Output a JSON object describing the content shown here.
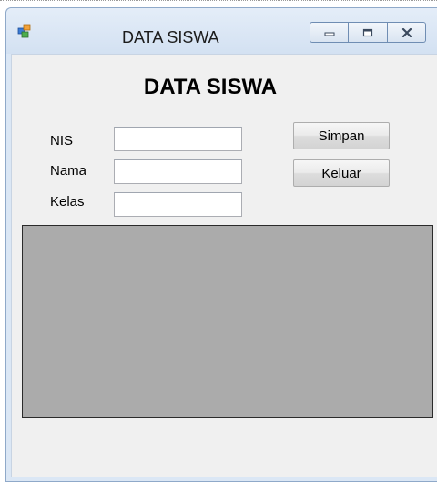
{
  "window": {
    "title": "DATA SISWA",
    "controls": {
      "minimize": "minimize",
      "maximize": "maximize",
      "close": "close"
    }
  },
  "form": {
    "heading": "DATA SISWA",
    "fields": [
      {
        "label": "NIS",
        "value": ""
      },
      {
        "label": "Nama",
        "value": ""
      },
      {
        "label": "Kelas",
        "value": ""
      }
    ],
    "buttons": {
      "save_label": "Simpan",
      "exit_label": "Keluar"
    }
  },
  "data_grid": {
    "rows": []
  },
  "colors": {
    "titlebar": "#dbe7f5",
    "client_background": "#f0f0f0",
    "grid_background": "#ababab"
  },
  "icons": [
    "app-window-icon",
    "minimize-icon",
    "maximize-icon",
    "close-icon"
  ]
}
